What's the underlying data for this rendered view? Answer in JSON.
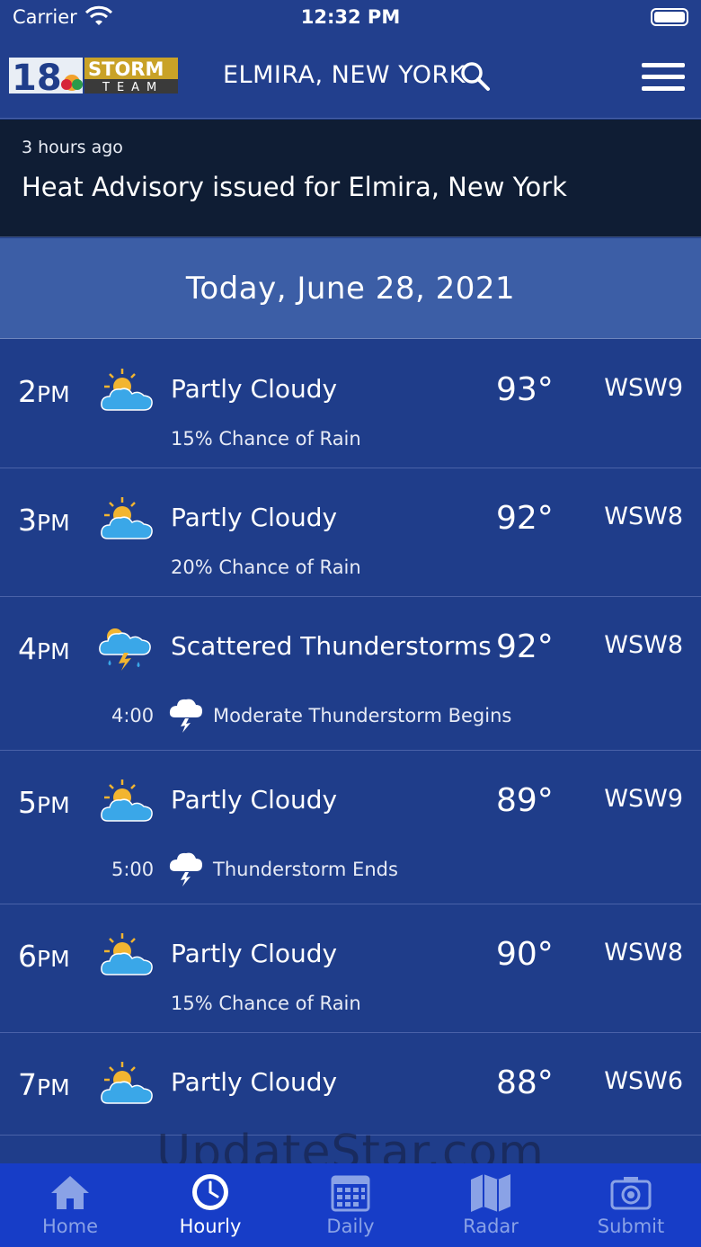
{
  "status": {
    "carrier": "Carrier",
    "time": "12:32 PM"
  },
  "header": {
    "location": "ELMIRA, NEW YORK",
    "logo_number": "18",
    "logo_word1": "STORM",
    "logo_word2": "TEAM"
  },
  "alert": {
    "ago": "3 hours ago",
    "headline": "Heat Advisory issued for Elmira, New York"
  },
  "date": "Today, June 28, 2021",
  "hours": [
    {
      "hour": "2",
      "ampm": "PM",
      "condition": "Partly Cloudy",
      "temp": "93°",
      "wind": "WSW9",
      "sub": "15% Chance of Rain",
      "icon": "partly-cloudy-icon"
    },
    {
      "hour": "3",
      "ampm": "PM",
      "condition": "Partly Cloudy",
      "temp": "92°",
      "wind": "WSW8",
      "sub": "20% Chance of Rain",
      "icon": "partly-cloudy-icon"
    },
    {
      "hour": "4",
      "ampm": "PM",
      "condition": "Scattered Thunderstorms",
      "temp": "92°",
      "wind": "WSW8",
      "event_time": "4:00",
      "event_text": "Moderate Thunderstorm Begins",
      "icon": "thunderstorm-icon"
    },
    {
      "hour": "5",
      "ampm": "PM",
      "condition": "Partly Cloudy",
      "temp": "89°",
      "wind": "WSW9",
      "event_time": "5:00",
      "event_text": "Thunderstorm Ends",
      "icon": "partly-cloudy-icon"
    },
    {
      "hour": "6",
      "ampm": "PM",
      "condition": "Partly Cloudy",
      "temp": "90°",
      "wind": "WSW8",
      "sub": "15% Chance of Rain",
      "icon": "partly-cloudy-icon"
    },
    {
      "hour": "7",
      "ampm": "PM",
      "condition": "Partly Cloudy",
      "temp": "88°",
      "wind": "WSW6",
      "icon": "partly-cloudy-icon"
    }
  ],
  "watermark": "UpdateStar.com",
  "tabs": [
    {
      "label": "Home",
      "icon": "home-icon",
      "active": false
    },
    {
      "label": "Hourly",
      "icon": "clock-icon",
      "active": true
    },
    {
      "label": "Daily",
      "icon": "calendar-icon",
      "active": false
    },
    {
      "label": "Radar",
      "icon": "map-icon",
      "active": false
    },
    {
      "label": "Submit",
      "icon": "camera-icon",
      "active": false
    }
  ],
  "colors": {
    "background": "#1f3d8a",
    "alert_bg": "#0f1d34",
    "date_bg": "#3c5ea6",
    "tab_bg": "#173dc7"
  }
}
